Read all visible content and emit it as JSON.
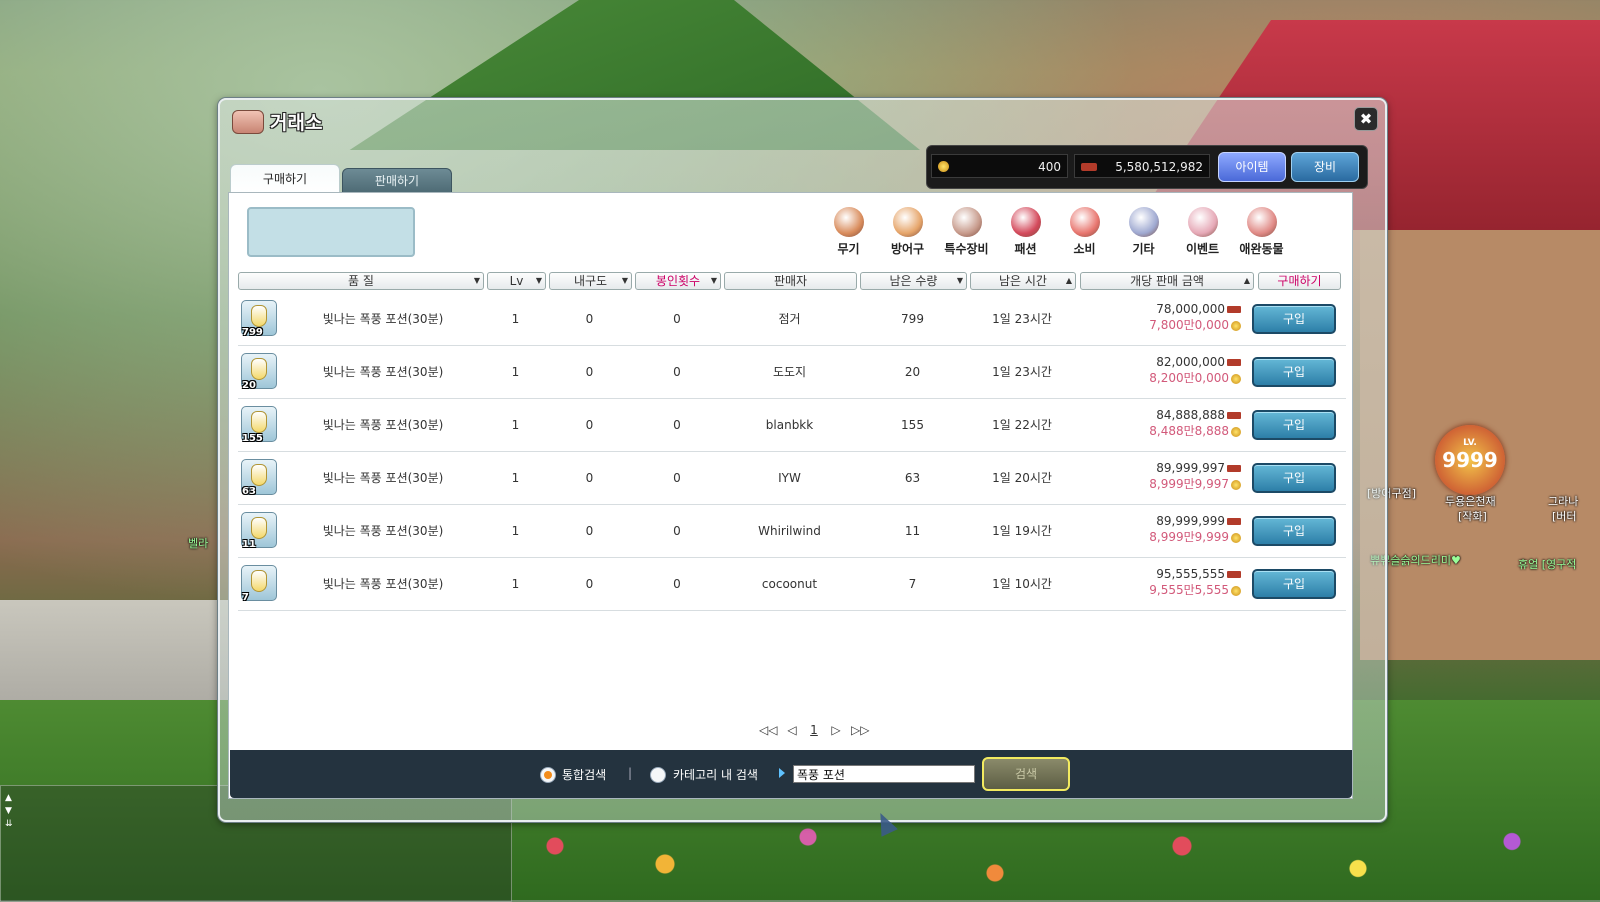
{
  "window": {
    "title": "거래소",
    "close_label": "✖"
  },
  "tabs": {
    "buy": "구매하기",
    "sell": "판매하기"
  },
  "currency": {
    "meso": "400",
    "maple_points": "5,580,512,982"
  },
  "mode_buttons": {
    "item": "아이템",
    "equip": "장비"
  },
  "categories": [
    {
      "label": "무기",
      "color": "#d98c5c"
    },
    {
      "label": "방어구",
      "color": "#e6a56a"
    },
    {
      "label": "특수장비",
      "color": "#c79a8b"
    },
    {
      "label": "패션",
      "color": "#d44a5c"
    },
    {
      "label": "소비",
      "color": "#e8766f"
    },
    {
      "label": "기타",
      "color": "#9fa9d1"
    },
    {
      "label": "이벤트",
      "color": "#e6a9b7"
    },
    {
      "label": "애완동물",
      "color": "#e08a86"
    }
  ],
  "columns": {
    "quality": "품 질",
    "level": "Lv",
    "durability": "내구도",
    "seal": "봉인횟수",
    "seller": "판매자",
    "remaining_qty": "남은 수량",
    "remaining_time": "남은 시간",
    "unit_price": "개당 판매 금액",
    "buy": "구매하기"
  },
  "listings": [
    {
      "qty_badge": "799",
      "name": "빛나는 폭풍 포션(30분)",
      "level": "1",
      "durability": "0",
      "seal": "0",
      "seller": "점거",
      "remaining_qty": "799",
      "remaining_time": "1일 23시간",
      "price": "78,000,000",
      "price_man": "7,800만0,000",
      "buy": "구입"
    },
    {
      "qty_badge": "20",
      "name": "빛나는 폭풍 포션(30분)",
      "level": "1",
      "durability": "0",
      "seal": "0",
      "seller": "도도지",
      "remaining_qty": "20",
      "remaining_time": "1일 23시간",
      "price": "82,000,000",
      "price_man": "8,200만0,000",
      "buy": "구입"
    },
    {
      "qty_badge": "155",
      "name": "빛나는 폭풍 포션(30분)",
      "level": "1",
      "durability": "0",
      "seal": "0",
      "seller": "blanbkk",
      "remaining_qty": "155",
      "remaining_time": "1일 22시간",
      "price": "84,888,888",
      "price_man": "8,488만8,888",
      "buy": "구입"
    },
    {
      "qty_badge": "63",
      "name": "빛나는 폭풍 포션(30분)",
      "level": "1",
      "durability": "0",
      "seal": "0",
      "seller": "IYW",
      "remaining_qty": "63",
      "remaining_time": "1일 20시간",
      "price": "89,999,997",
      "price_man": "8,999만9,997",
      "buy": "구입"
    },
    {
      "qty_badge": "11",
      "name": "빛나는 폭풍 포션(30분)",
      "level": "1",
      "durability": "0",
      "seal": "0",
      "seller": "Whirilwind",
      "remaining_qty": "11",
      "remaining_time": "1일 19시간",
      "price": "89,999,999",
      "price_man": "8,999만9,999",
      "buy": "구입"
    },
    {
      "qty_badge": "7",
      "name": "빛나는 폭풍 포션(30분)",
      "level": "1",
      "durability": "0",
      "seal": "0",
      "seller": "cocoonut",
      "remaining_qty": "7",
      "remaining_time": "1일 10시간",
      "price": "95,555,555",
      "price_man": "9,555만5,555",
      "buy": "구입"
    }
  ],
  "pager": {
    "first": "◁◁",
    "prev": "◁",
    "page": "1",
    "next": "▷",
    "last": "▷▷"
  },
  "search": {
    "mode_all": "통합검색",
    "mode_category": "카테고리 내 검색",
    "separator": "|",
    "query": "폭풍 포션",
    "button": "검색"
  },
  "scene": {
    "level_badge_top": "LV.",
    "level_badge_num": "9999",
    "labels": [
      "[방어구점]",
      "두용은천재",
      "[작화]",
      "그라나",
      "[버터",
      "벨라",
      "쀼쀼슬슭의드리미♥",
      "휴얼 [영구적"
    ]
  }
}
